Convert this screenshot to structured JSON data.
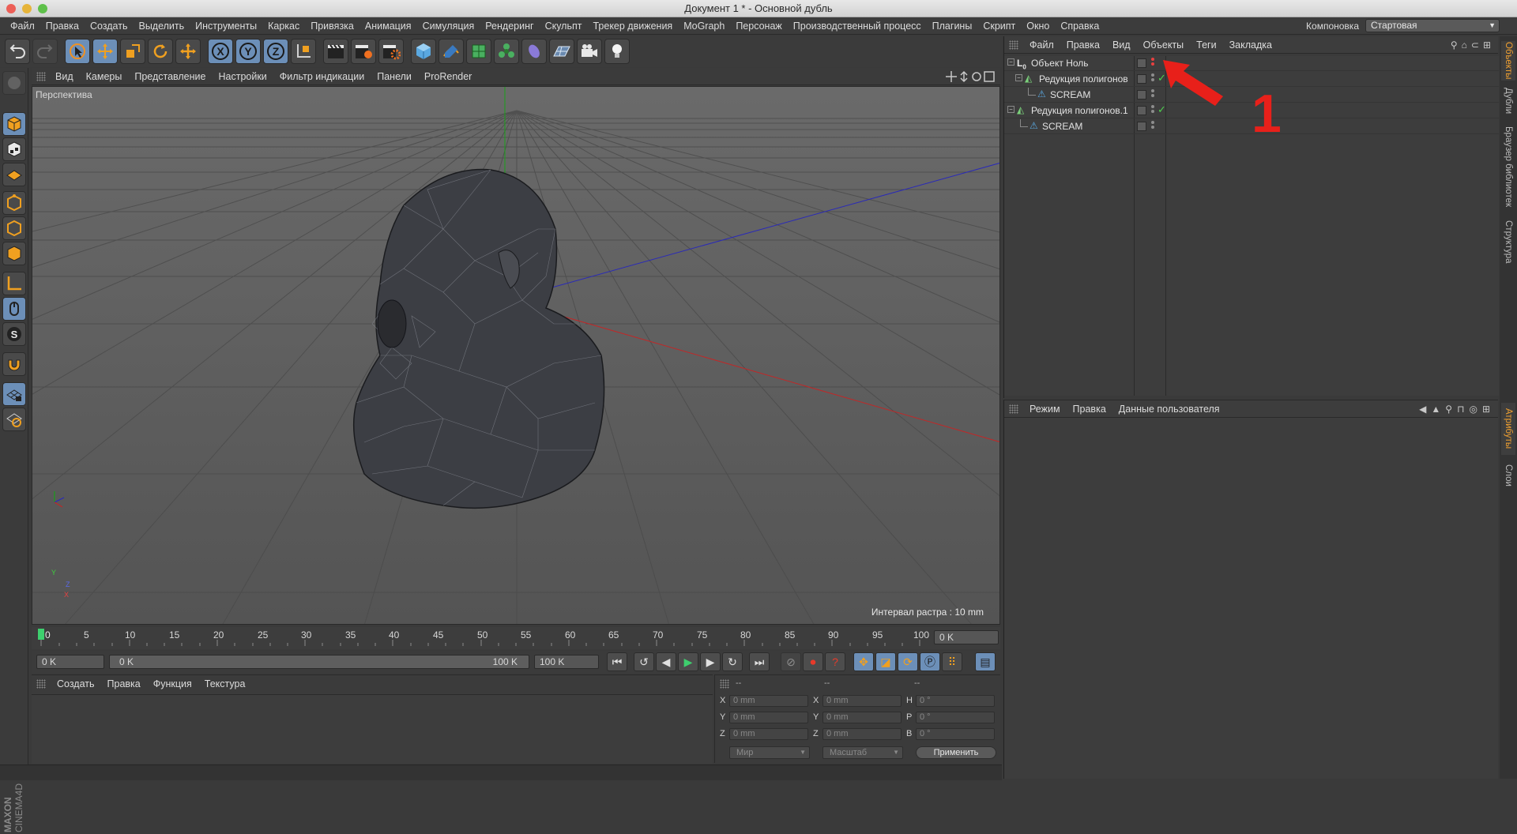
{
  "window": {
    "title": "Документ 1 * - Основной дубль"
  },
  "menubar": {
    "items": [
      "Файл",
      "Правка",
      "Создать",
      "Выделить",
      "Инструменты",
      "Каркас",
      "Привязка",
      "Анимация",
      "Симуляция",
      "Рендеринг",
      "Скульпт",
      "Трекер движения",
      "MoGraph",
      "Персонаж",
      "Производственный процесс",
      "Плагины",
      "Скрипт",
      "Окно",
      "Справка"
    ],
    "layout_label": "Компоновка",
    "layout_value": "Стартовая"
  },
  "viewport": {
    "menu": [
      "Вид",
      "Камеры",
      "Представление",
      "Настройки",
      "Фильтр индикации",
      "Панели",
      "ProRender"
    ],
    "camera_label": "Перспектива",
    "grid_interval": "Интервал растра : 10 mm",
    "axis_labels": {
      "y": "Y",
      "z": "Z",
      "x": "X"
    }
  },
  "timeline": {
    "ticks": [
      "0",
      "5",
      "10",
      "15",
      "20",
      "25",
      "30",
      "35",
      "40",
      "45",
      "50",
      "55",
      "60",
      "65",
      "70",
      "75",
      "80",
      "85",
      "90",
      "95",
      "100"
    ],
    "current_frame": "0 K"
  },
  "transport": {
    "start_field": "0 K",
    "range_start": "0 K",
    "range_end": "100 K",
    "end_field": "100 K"
  },
  "material_panel": {
    "menu": [
      "Создать",
      "Правка",
      "Функция",
      "Текстура"
    ]
  },
  "coord_panel": {
    "headers": [
      "--",
      "--",
      "--"
    ],
    "rows": [
      {
        "l1": "X",
        "v1": "0 mm",
        "l2": "X",
        "v2": "0 mm",
        "l3": "H",
        "v3": "0 °"
      },
      {
        "l1": "Y",
        "v1": "0 mm",
        "l2": "Y",
        "v2": "0 mm",
        "l3": "P",
        "v3": "0 °"
      },
      {
        "l1": "Z",
        "v1": "0 mm",
        "l2": "Z",
        "v2": "0 mm",
        "l3": "B",
        "v3": "0 °"
      }
    ],
    "world_select": "Мир",
    "scale_select": "Масштаб",
    "apply_button": "Применить"
  },
  "object_manager": {
    "menu": [
      "Файл",
      "Правка",
      "Вид",
      "Объекты",
      "Теги",
      "Закладка"
    ],
    "objects": [
      {
        "name": "Объект Ноль",
        "type": "null",
        "check": ""
      },
      {
        "name": "Редукция полигонов",
        "type": "reduction",
        "check": "✓"
      },
      {
        "name": "SCREAM",
        "type": "mesh",
        "check": ""
      },
      {
        "name": "Редукция полигонов.1",
        "type": "reduction",
        "check": "✓"
      },
      {
        "name": "SCREAM",
        "type": "mesh",
        "check": ""
      }
    ]
  },
  "attribute_manager": {
    "menu": [
      "Режим",
      "Правка",
      "Данные пользователя"
    ]
  },
  "right_tabs": {
    "top": [
      "Объекты",
      "Дубли",
      "Браузер библиотек",
      "Структура"
    ],
    "bottom": [
      "Атрибуты",
      "Слои"
    ]
  },
  "annotation": {
    "number": "1",
    "color": "#e8201a"
  },
  "branding": {
    "logo_text": "MAXON CINEMA4D"
  }
}
